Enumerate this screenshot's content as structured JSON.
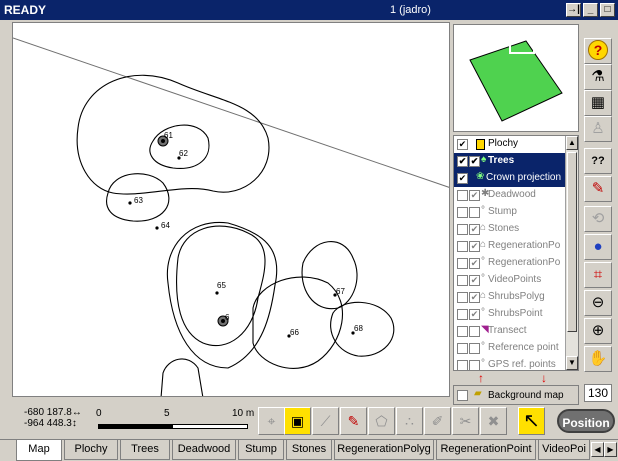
{
  "title": {
    "status": "READY",
    "context": "1 (jadro)"
  },
  "window_buttons": [
    "→|",
    "_",
    "□"
  ],
  "layers": [
    {
      "label": "Plochy",
      "checked": true,
      "state": "normal"
    },
    {
      "label": "Trees",
      "checked": true,
      "state": "selected"
    },
    {
      "label": "Crown projection",
      "checked": true,
      "state": "selected"
    },
    {
      "label": "Deadwood",
      "checked": true,
      "state": "dim"
    },
    {
      "label": "Stump",
      "checked": false,
      "state": "dim"
    },
    {
      "label": "Stones",
      "checked": true,
      "state": "dim"
    },
    {
      "label": "RegenerationPo",
      "checked": true,
      "state": "dim"
    },
    {
      "label": "RegenerationPo",
      "checked": true,
      "state": "dim"
    },
    {
      "label": "VideoPoints",
      "checked": true,
      "state": "dim"
    },
    {
      "label": "ShrubsPolyg",
      "checked": true,
      "state": "dim"
    },
    {
      "label": "ShrubsPoint",
      "checked": true,
      "state": "dim"
    },
    {
      "label": "Transect",
      "checked": false,
      "state": "dim"
    },
    {
      "label": "Reference point",
      "checked": false,
      "state": "dim"
    },
    {
      "label": "GPS ref. points",
      "checked": false,
      "state": "dim"
    }
  ],
  "background_map": {
    "label": "Background map",
    "checked": false
  },
  "zoom_value": "130",
  "coords": {
    "x": "-680 187.8↔",
    "y": "-964 448.3↕"
  },
  "scale": {
    "labels": [
      "0",
      "5",
      "10 m"
    ]
  },
  "position_button": "Position",
  "map_labels": [
    "61",
    "62",
    "63",
    "64",
    "65",
    "6",
    "66",
    "67",
    "68"
  ],
  "tabs": [
    "Map",
    "Plochy",
    "Trees",
    "Deadwood",
    "Stump",
    "Stones",
    "RegenerationPolyg",
    "RegenerationPoint",
    "VideoPoi"
  ],
  "icons": {
    "right": [
      "help-icon",
      "tools-icon",
      "table-icon",
      "person-icon",
      "query-icon",
      "select-tool-icon",
      "rotate-icon",
      "globe-icon",
      "zoom-extent-icon",
      "zoom-out-icon",
      "zoom-in-icon",
      "hand-icon"
    ],
    "bottom": [
      "gps-icon",
      "monitor-icon",
      "measure-icon",
      "draw-line-icon",
      "polygon-icon",
      "points-icon",
      "edit-icon",
      "cut-icon",
      "delete-icon",
      "arrow-cursor-icon"
    ]
  },
  "colors": {
    "titlebar": "#0a246a",
    "selection": "#0a246a",
    "overview_fill": "#4fd24f"
  }
}
